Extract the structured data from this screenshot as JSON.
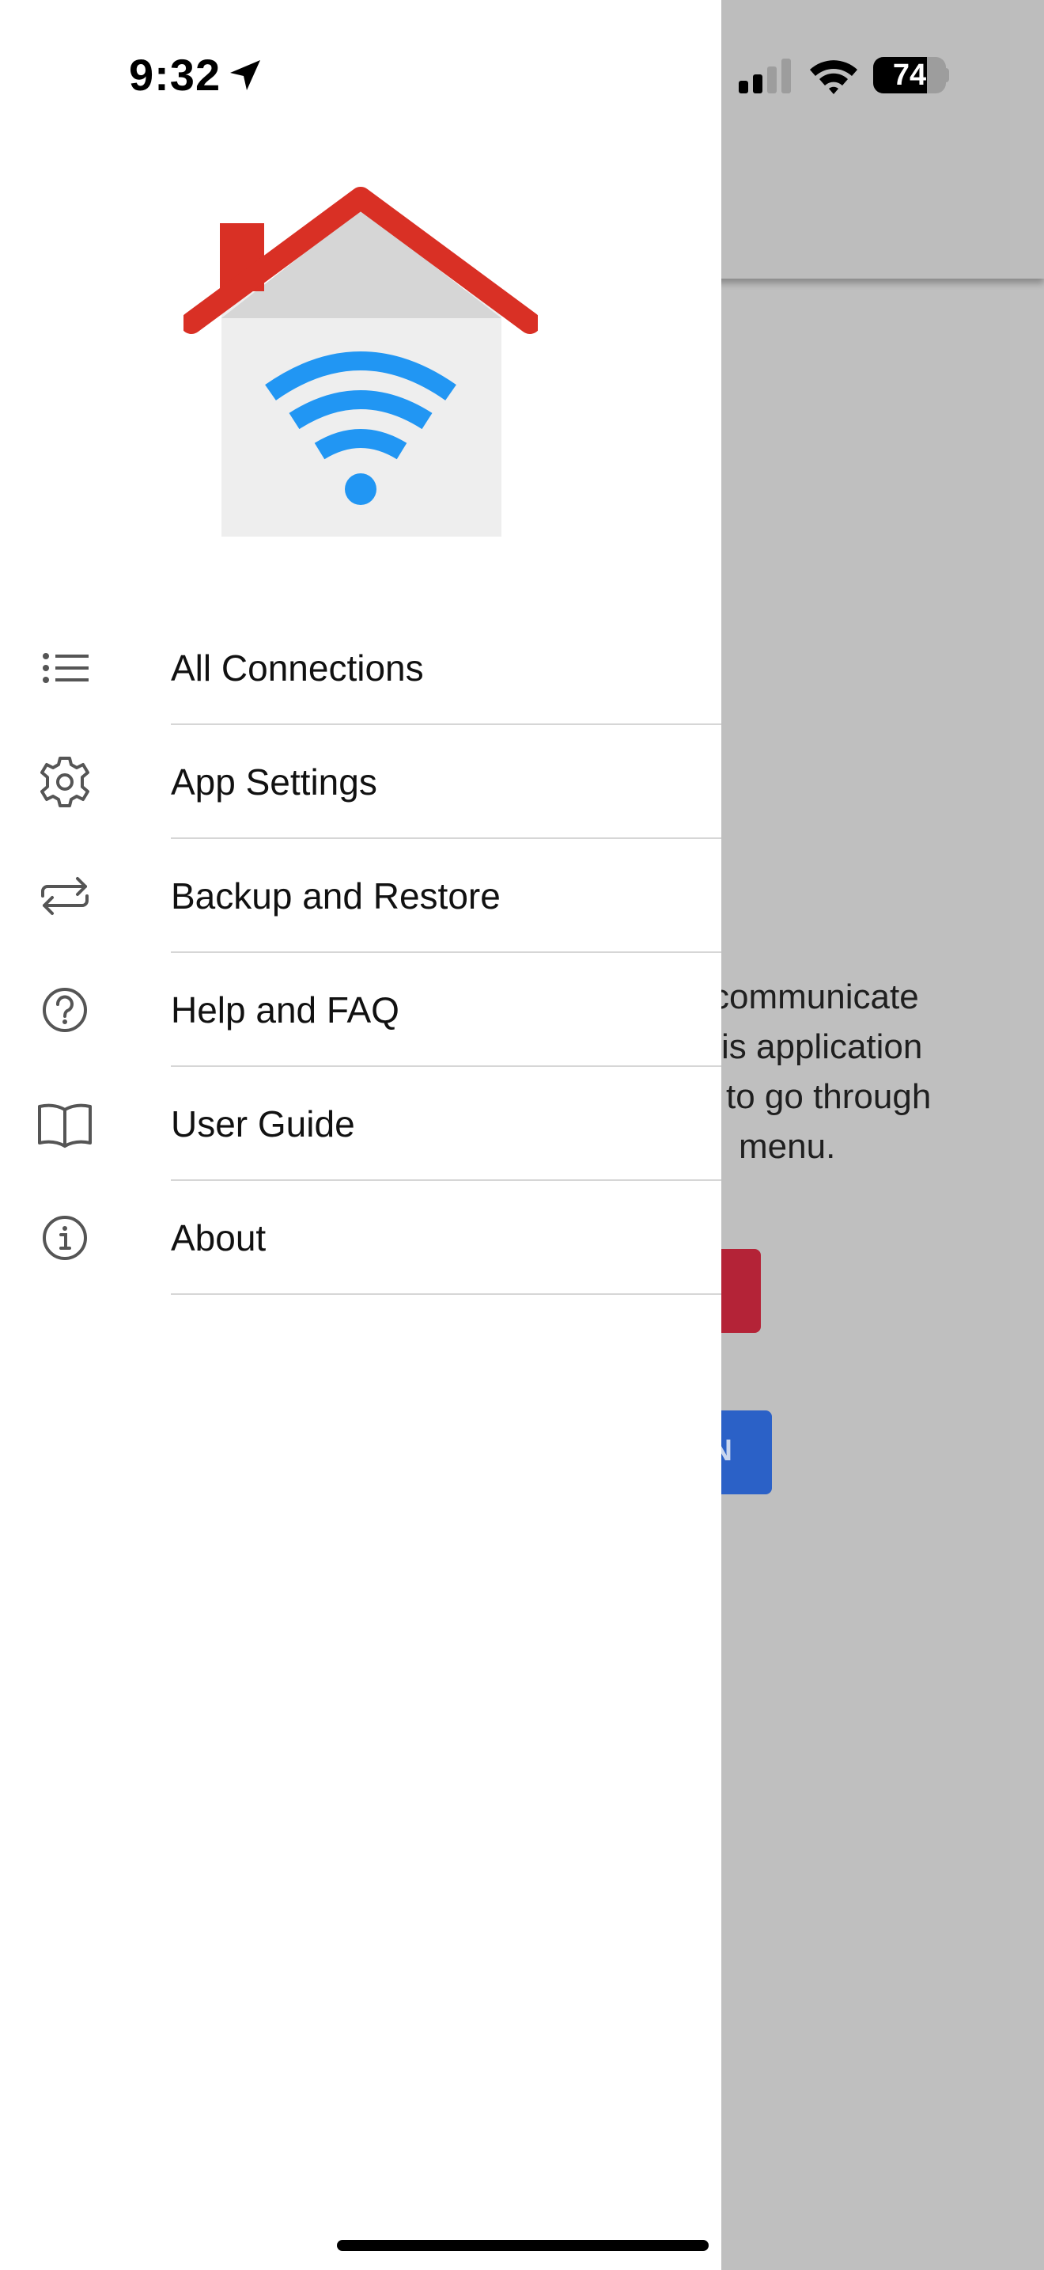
{
  "status_bar": {
    "time": "9:32",
    "battery_level": "74",
    "icons": [
      "location-arrow-icon",
      "cellular-signal-icon",
      "wifi-icon",
      "battery-icon"
    ]
  },
  "background_app": {
    "body_lines": [
      "communicate",
      "is application",
      "to go through",
      "menu."
    ],
    "blue_button_fragment": "N",
    "colors": {
      "red_button": "#b42337",
      "blue_button": "#2b61c7",
      "overlay": "#bfbfbf"
    }
  },
  "drawer": {
    "logo": {
      "name": "house-wifi-logo",
      "colors": {
        "roof": "#d93025",
        "wall": "#eeeeee",
        "wifi": "#2196f3"
      }
    },
    "menu": [
      {
        "label": "All Connections",
        "icon": "list-icon"
      },
      {
        "label": "App Settings",
        "icon": "gear-icon"
      },
      {
        "label": "Backup and Restore",
        "icon": "sync-arrows-icon"
      },
      {
        "label": "Help and FAQ",
        "icon": "help-circle-icon"
      },
      {
        "label": "User Guide",
        "icon": "book-icon"
      },
      {
        "label": "About",
        "icon": "info-circle-icon"
      }
    ]
  }
}
